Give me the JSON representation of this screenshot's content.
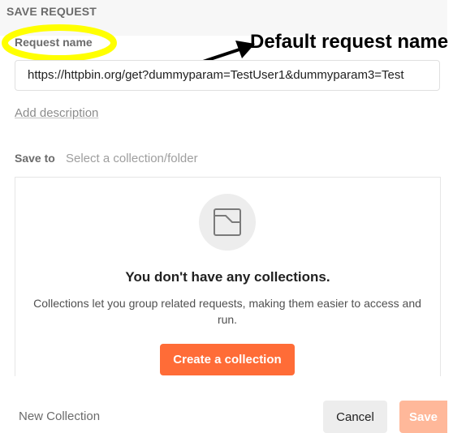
{
  "dialog": {
    "title": "SAVE REQUEST"
  },
  "request_name": {
    "label": "Request name",
    "value": "https://httpbin.org/get?dummyparam=TestUser1&dummyparam3=Test"
  },
  "annotation": {
    "text": "Default request name",
    "highlight_color": "#ffff00",
    "arrow_color": "#000000"
  },
  "description": {
    "link_label": "Add description"
  },
  "save_to": {
    "label": "Save to",
    "placeholder": "Select a collection/folder"
  },
  "empty_state": {
    "icon": "collection-folder-icon",
    "title": "You don't have any collections.",
    "description": "Collections let you group related requests, making them easier to access and run.",
    "button_label": "Create a collection"
  },
  "footer": {
    "new_collection_label": "New Collection",
    "cancel_label": "Cancel",
    "save_label": "Save"
  },
  "colors": {
    "accent": "#ff6c37",
    "accent_disabled": "#ffb89a"
  }
}
